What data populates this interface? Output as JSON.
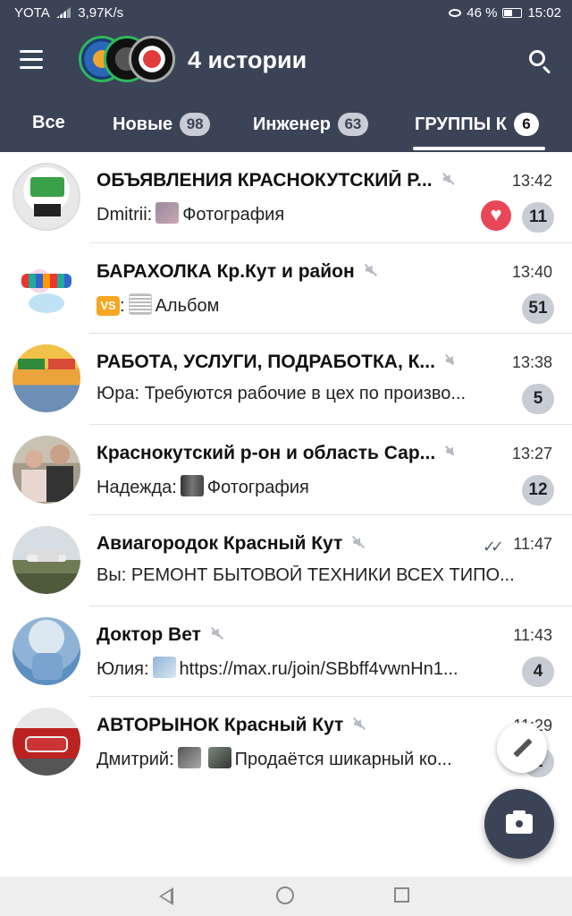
{
  "status_bar": {
    "carrier": "YOTA",
    "network": "4G",
    "speed": "3,97K/s",
    "battery": "46 %",
    "time": "15:02"
  },
  "header": {
    "title": "4 истории",
    "menu_icon": "hamburger-menu-icon",
    "search_icon": "search-icon"
  },
  "tabs": [
    {
      "label": "Все",
      "badge": ""
    },
    {
      "label": "Новые",
      "badge": "98"
    },
    {
      "label": "Инженер",
      "badge": "63"
    },
    {
      "label": "ГРУППЫ К",
      "badge": "6"
    }
  ],
  "chats": [
    {
      "name": "ОБЪЯВЛЕНИЯ КРАСНОКУТСКИЙ Р...",
      "time": "13:42",
      "sender": "Dmitrii:",
      "text": "Фотография",
      "unread": "11"
    },
    {
      "name": "БАРАХОЛКА Кр.Кут и район",
      "time": "13:40",
      "sender": "VS",
      "text": "Альбом",
      "unread": "51"
    },
    {
      "name": "РАБОТА, УСЛУГИ, ПОДРАБОТКА, К...",
      "time": "13:38",
      "sender": "Юра:",
      "text": "Требуются рабочие в цех по произво...",
      "unread": "5"
    },
    {
      "name": "Краснокутский р-он и область Сар...",
      "time": "13:27",
      "sender": "Надежда:",
      "text": "Фотография",
      "unread": "12"
    },
    {
      "name": "Авиагородок Красный Кут",
      "time": "11:47",
      "sender": "Вы:",
      "text": "РЕМОНТ БЫТОВОЙ ТЕХНИКИ ВСЕХ ТИПО...",
      "unread": ""
    },
    {
      "name": "Доктор Вет",
      "time": "11:43",
      "sender": "Юлия:",
      "text": "https://max.ru/join/SBbff4vwnHn1...",
      "unread": "4"
    },
    {
      "name": "АВТОРЫНОК Красный Кут",
      "time": "11:29",
      "sender": "Дмитрий:",
      "text": "Продаётся шикарный ко...",
      "unread": "1"
    }
  ],
  "colors": {
    "header_bg": "#3b4357",
    "badge_bg": "#c8ccd4",
    "reaction": "#e84757"
  }
}
